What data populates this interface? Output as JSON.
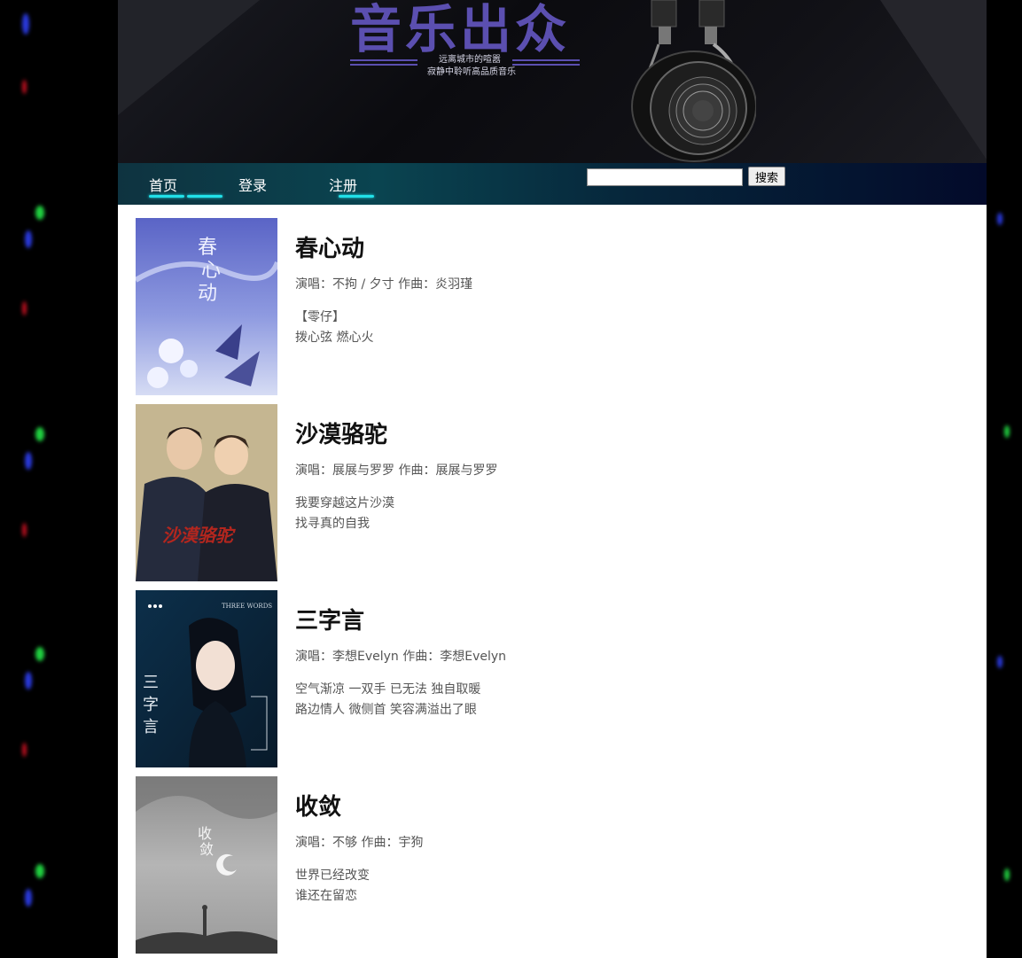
{
  "banner": {
    "title": "音乐出众",
    "subtitle_1": "远离城市的喧嚣",
    "subtitle_2": "寂静中聆听高品质音乐"
  },
  "nav": {
    "home": "首页",
    "login": "登录",
    "register": "注册",
    "search_value": "",
    "search_button": "搜索"
  },
  "songs": [
    {
      "title": "春心动",
      "meta": "演唱：不拘 / 夕寸 作曲：炎羽瑾",
      "line1": "【零仔】",
      "line2": "拨心弦 燃心火"
    },
    {
      "title": "沙漠骆驼",
      "meta": "演唱：展展与罗罗 作曲：展展与罗罗",
      "line1": "我要穿越这片沙漠",
      "line2": "找寻真的自我"
    },
    {
      "title": "三字言",
      "meta": "演唱：李想Evelyn 作曲：李想Evelyn",
      "line1": "空气渐凉 一双手 已无法 独自取暖",
      "line2": "路边情人 微侧首 笑容满溢出了眼"
    },
    {
      "title": "收敛",
      "meta": "演唱：不够 作曲：宇狗",
      "line1": "世界已经改变",
      "line2": "谁还在留恋"
    }
  ],
  "cover_text": {
    "cover1": "春心动",
    "cover2": "沙漠骆驼",
    "cover3_en": "THREE WORDS",
    "cover3_cn": "三字言",
    "cover4": "收敛"
  },
  "colors": {
    "accent": "#21e0e8",
    "title": "#5b4fb0"
  }
}
